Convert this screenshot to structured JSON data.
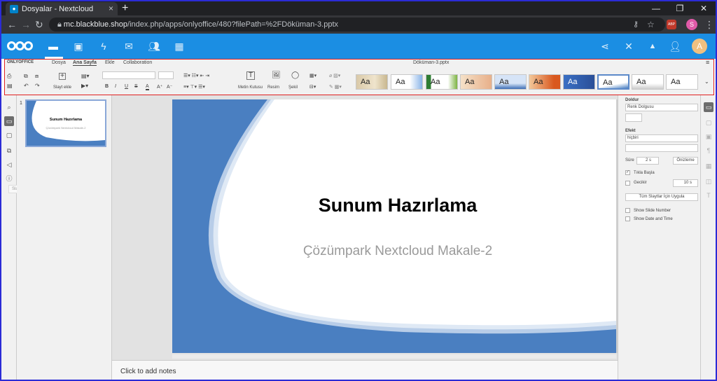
{
  "browser": {
    "tab_title": "Dosyalar - Nextcloud",
    "url_host": "mc.blackblue.shop",
    "url_path": "/index.php/apps/onlyoffice/480?filePath=%2FDöküman-3.pptx",
    "profile_initial": "S",
    "ext_label": "ABP"
  },
  "nextcloud": {
    "avatar_initial": "A",
    "apps": [
      "files-icon",
      "photos-icon",
      "activity-icon",
      "mail-icon",
      "contacts-icon",
      "calendar-icon"
    ]
  },
  "onlyoffice": {
    "brand": "ONLYOFFICE",
    "tabs": [
      "Dosya",
      "Ana Sayfa",
      "Ekle",
      "Collaboration"
    ],
    "active_tab": "Ana Sayfa",
    "doc_title": "Döküman-3.pptx",
    "toolbar": {
      "add_slide": "Slayt ekle",
      "text_box": "Metin Kutusu",
      "image": "Resim",
      "shape": "Şekil"
    },
    "theme_label": "Aa",
    "tooltip": "Slaytlar"
  },
  "slide": {
    "number": "1",
    "title": "Sunum Hazırlama",
    "subtitle": "Çözümpark Nextcloud Makale-2"
  },
  "notes_placeholder": "Click to add notes",
  "right_panel": {
    "fill_label": "Doldur",
    "fill_value": "Renk Dolgusu",
    "effect_label": "Efekt",
    "effect_value": "hiçbiri",
    "duration_label": "Süre",
    "duration_value": "2 s",
    "preview_button": "Önizleme",
    "on_click_label": "Tıkla Başla",
    "delay_label": "Gecikir",
    "delay_value": "10 s",
    "apply_all_button": "Tüm Slaytlar İçin Uygula",
    "show_slide_number": "Show Slide Number",
    "show_date_time": "Show Date and Time"
  },
  "colors": {
    "nextcloud_blue": "#1b8ee3",
    "slide_blue": "#4a7fc1",
    "highlight_red": "#e02020"
  }
}
